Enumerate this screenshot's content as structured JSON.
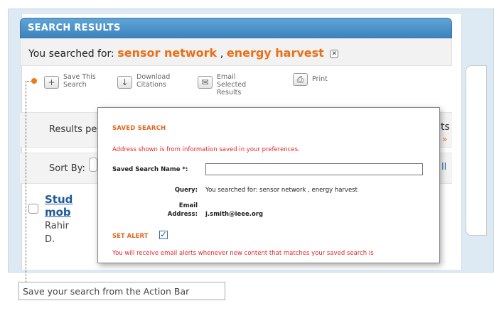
{
  "results_header": {
    "title": "SEARCH RESULTS"
  },
  "search_summary": {
    "prefix": "You searched for:",
    "terms": [
      "sensor network",
      "energy harvest"
    ],
    "separator": ",",
    "remove_icon": "close-icon"
  },
  "action_bar": {
    "save_search": {
      "label": "Save This Search",
      "icon": "plus-icon"
    },
    "download_citations": {
      "label": "Download Citations",
      "icon": "download-arrow-icon"
    },
    "email_results": {
      "label": "Email Selected Results",
      "icon": "envelope-icon"
    },
    "print": {
      "label": "Print",
      "icon": "printer-icon"
    }
  },
  "results_per_page": {
    "label": "Results pe"
  },
  "sort": {
    "label": "Sort By:"
  },
  "edge_fragments": {
    "ts": "ts",
    "chev": "»",
    "ll": "ll"
  },
  "result": {
    "title_line1": "Stud",
    "title_line2": "mob",
    "author_line1": "Rahir",
    "author_line2": "D."
  },
  "modal": {
    "title": "SAVED SEARCH",
    "note": "Address shown is from information saved in your preferences.",
    "name_label": "Saved Search Name *:",
    "name_value": "",
    "query_label": "Query:",
    "query_value": "You searched for: sensor network , energy harvest",
    "email_label_line1": "Email",
    "email_label_line2": "Address:",
    "email_value": "j.smith@ieee.org",
    "alert_label": "SET ALERT",
    "alert_checked": true,
    "alert_note": "You will receive email alerts whenever new content that matches your saved search is"
  },
  "callout": {
    "caption": "Save your search from the Action Bar"
  },
  "colors": {
    "accent_orange": "#ea7016",
    "header_blue": "#3d83bd",
    "link_blue": "#1c5a9a",
    "note_red": "#e2262c"
  }
}
